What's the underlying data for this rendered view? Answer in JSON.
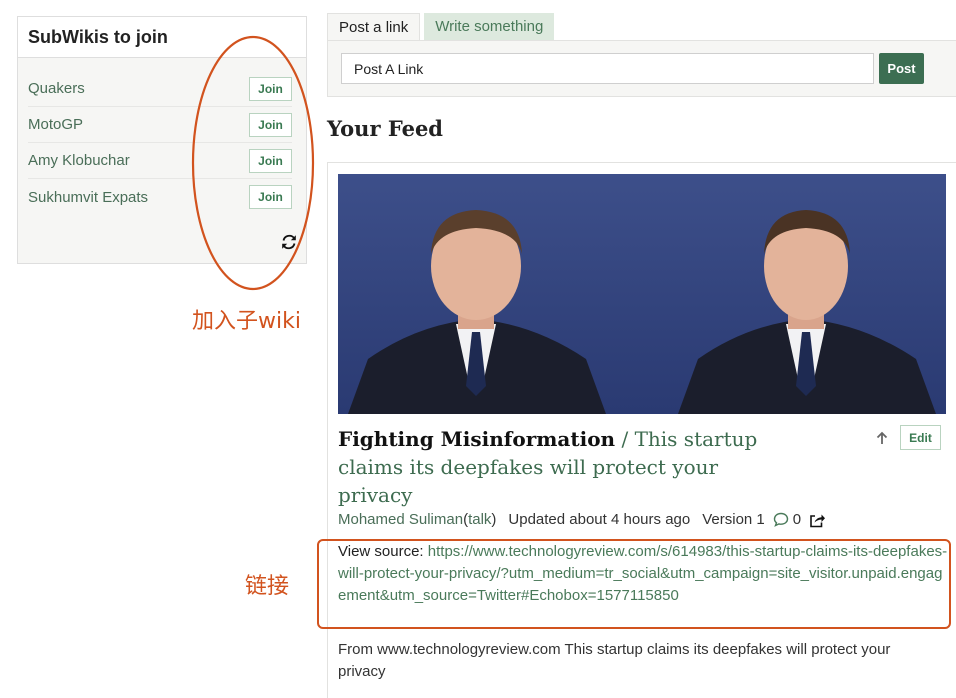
{
  "sidebar": {
    "title": "SubWikis to join",
    "items": [
      {
        "name": "Quakers",
        "action": "Join"
      },
      {
        "name": "MotoGP",
        "action": "Join"
      },
      {
        "name": "Amy Klobuchar",
        "action": "Join"
      },
      {
        "name": "Sukhumvit Expats",
        "action": "Join"
      }
    ],
    "refresh_icon": "refresh-icon"
  },
  "annotations": {
    "join_label": "加入子wiki",
    "link_label": "链接",
    "color": "#d2531e"
  },
  "post_box": {
    "tabs": [
      {
        "label": "Post a link",
        "active": true
      },
      {
        "label": "Write something",
        "active": false
      }
    ],
    "input_value": "Post A Link",
    "post_button": "Post"
  },
  "feed": {
    "heading": "Your Feed",
    "post": {
      "title_main": "Fighting Misinformation",
      "title_separator": " / ",
      "title_sub": "This startup claims its deepfakes will protect your privacy",
      "edit_label": "Edit",
      "author": "Mohamed Suliman",
      "talk_open": " (",
      "talk": "talk",
      "talk_close": ")",
      "updated": "Updated about 4 hours ago",
      "version": "Version 1",
      "comment_count": "0",
      "source_label": "View source: ",
      "source_url": "https://www.technologyreview.com/s/614983/this-startup-claims-its-deepfakes-will-protect-your-privacy/?utm_medium=tr_social&utm_campaign=site_visitor.unpaid.engagement&utm_source=Twitter#Echobox=1577115850",
      "from_text": "From www.technologyreview.com   This startup claims its deepfakes will protect your privacy"
    }
  },
  "colors": {
    "accent_green": "#3c6e52",
    "link_green": "#4a7a5a",
    "annotation": "#d2531e"
  }
}
